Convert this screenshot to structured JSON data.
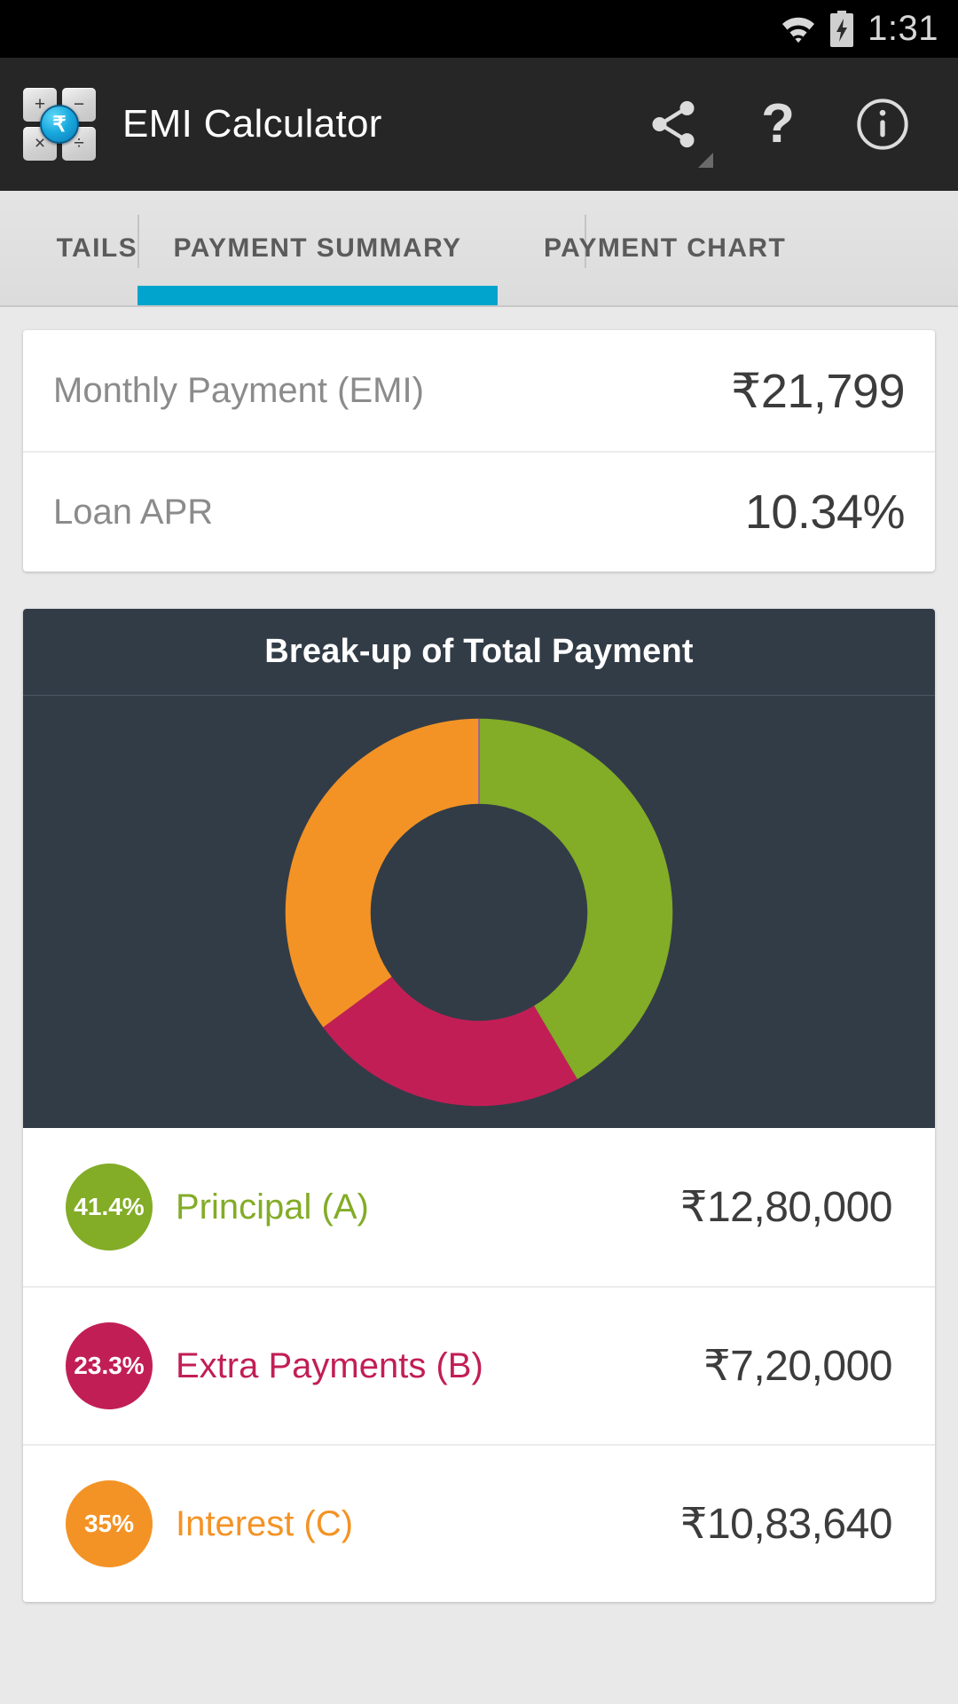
{
  "status_bar": {
    "wifi_icon": "wifi-icon",
    "battery_icon": "battery-charging-icon",
    "time": "1:31"
  },
  "action_bar": {
    "app_icon": "calculator-rupee-icon",
    "app_icon_keys": [
      "+",
      "−",
      "×",
      "÷"
    ],
    "app_icon_center": "₹",
    "title": "EMI Calculator",
    "actions": [
      {
        "name": "share-icon",
        "label": "Share"
      },
      {
        "name": "help-icon",
        "label": "?"
      },
      {
        "name": "info-icon",
        "label": "Info"
      }
    ],
    "help_glyph": "?"
  },
  "tabs": {
    "items": [
      {
        "label": "TAILS",
        "active": false
      },
      {
        "label": "PAYMENT SUMMARY",
        "active": true
      },
      {
        "label": "PAYMENT CHART",
        "active": false
      }
    ],
    "active_index": 1,
    "indicator_color": "#00a4cc"
  },
  "summary_card": {
    "rows": [
      {
        "label": "Monthly Payment (EMI)",
        "value": "₹21,799"
      },
      {
        "label": "Loan APR",
        "value": "10.34%"
      }
    ]
  },
  "chart_card": {
    "title": "Break-up of Total Payment"
  },
  "chart_data": {
    "type": "pie",
    "title": "Break-up of Total Payment",
    "donut": true,
    "inner_radius_ratio": 0.56,
    "start_angle_deg": -90,
    "direction": "clockwise",
    "background": "#323c47",
    "labels": [
      "Principal (A)",
      "Extra Payments (B)",
      "Interest (C)"
    ],
    "percents": [
      41.4,
      23.3,
      35.0
    ],
    "values": [
      1280000,
      720000,
      1083640
    ],
    "value_labels": [
      "₹12,80,000",
      "₹7,20,000",
      "₹10,83,640"
    ],
    "colors": [
      "#83ac27",
      "#c21e56",
      "#f39325"
    ],
    "legend_position": "bottom",
    "grid": false
  },
  "legend": {
    "rows": [
      {
        "percent": "41.4%",
        "label": "Principal (A)",
        "amount": "₹12,80,000",
        "color": "#83ac27"
      },
      {
        "percent": "23.3%",
        "label": "Extra Payments (B)",
        "amount": "₹7,20,000",
        "color": "#c21e56"
      },
      {
        "percent": "35%",
        "label": "Interest (C)",
        "amount": "₹10,83,640",
        "color": "#f39325"
      }
    ]
  }
}
